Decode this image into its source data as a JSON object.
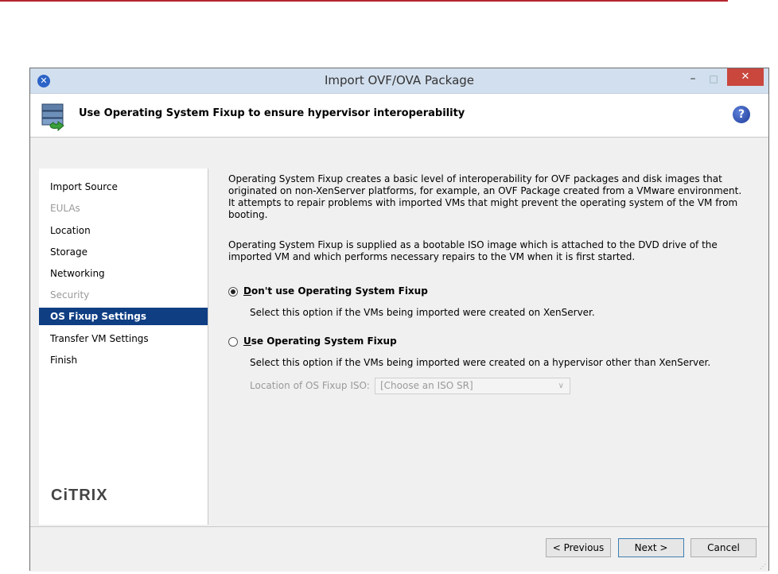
{
  "window": {
    "title": "Import OVF/OVA Package",
    "controls": {
      "minimize": "–",
      "maximize": "□",
      "close": "✕"
    }
  },
  "header": {
    "title": "Use Operating System Fixup to ensure hypervisor interoperability",
    "help": "?"
  },
  "sidebar": {
    "items": [
      {
        "label": "Import Source",
        "state": "normal"
      },
      {
        "label": "EULAs",
        "state": "disabled"
      },
      {
        "label": "Location",
        "state": "normal"
      },
      {
        "label": "Storage",
        "state": "normal"
      },
      {
        "label": "Networking",
        "state": "normal"
      },
      {
        "label": "Security",
        "state": "disabled"
      },
      {
        "label": "OS Fixup Settings",
        "state": "active"
      },
      {
        "label": "Transfer VM Settings",
        "state": "normal"
      },
      {
        "label": "Finish",
        "state": "normal"
      }
    ],
    "logo": "CiTRIX"
  },
  "content": {
    "para1": "Operating System Fixup creates a basic level of interoperability for OVF packages and disk images that originated on non-XenServer platforms, for example, an OVF Package created from a VMware environment. It attempts to repair problems with imported VMs that might prevent the operating system of the VM from booting.",
    "para2": "Operating System Fixup is supplied as a bootable ISO image which is attached to the DVD drive of the imported VM and which performs necessary repairs to the VM when it is first started.",
    "option1": {
      "mnemonic": "D",
      "rest": "on't use Operating System Fixup",
      "description": "Select this option if the VMs being imported were created on XenServer.",
      "checked": true
    },
    "option2": {
      "mnemonic": "U",
      "rest": "se Operating System Fixup",
      "description": "Select this option if the VMs being imported were created on a hypervisor other than XenServer.",
      "checked": false
    },
    "iso": {
      "label": "Location of OS Fixup ISO:",
      "value": "[Choose an ISO SR]"
    }
  },
  "footer": {
    "previous": "< Previous",
    "next": "Next >",
    "cancel": "Cancel"
  }
}
